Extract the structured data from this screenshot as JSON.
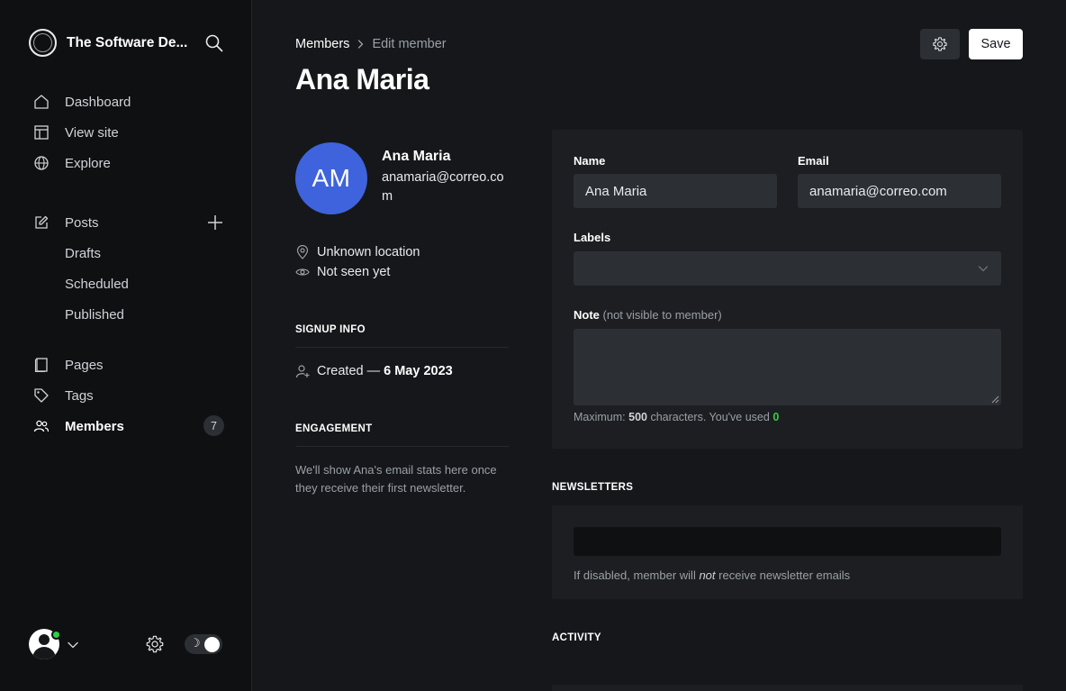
{
  "sidebar": {
    "site_title": "The Software De...",
    "nav_primary": [
      {
        "label": "Dashboard",
        "icon": "home-icon"
      },
      {
        "label": "View site",
        "icon": "layout-icon"
      },
      {
        "label": "Explore",
        "icon": "globe-icon"
      }
    ],
    "posts": {
      "label": "Posts",
      "icon": "edit-icon"
    },
    "posts_sub": [
      {
        "label": "Drafts"
      },
      {
        "label": "Scheduled"
      },
      {
        "label": "Published"
      }
    ],
    "nav_secondary": [
      {
        "label": "Pages",
        "icon": "page-icon"
      },
      {
        "label": "Tags",
        "icon": "tag-icon"
      },
      {
        "label": "Members",
        "icon": "members-icon",
        "badge": "7",
        "active": true
      }
    ],
    "theme_icon": "☽"
  },
  "header": {
    "breadcrumb_parent": "Members",
    "breadcrumb_current": "Edit member",
    "title": "Ana Maria",
    "save_label": "Save"
  },
  "member": {
    "initials": "AM",
    "name": "Ana Maria",
    "email": "anamaria@correo.com",
    "location": "Unknown location",
    "last_seen": "Not seen yet",
    "signup_heading": "SIGNUP INFO",
    "created_prefix": "Created —",
    "created_date": "6 May 2023",
    "engagement_heading": "ENGAGEMENT",
    "engagement_text": "We'll show Ana's email stats here once they receive their first newsletter."
  },
  "form": {
    "name_label": "Name",
    "name_value": "Ana Maria",
    "email_label": "Email",
    "email_value": "anamaria@correo.com",
    "labels_label": "Labels",
    "note_label": "Note",
    "note_hint": "(not visible to member)",
    "counter_prefix": "Maximum:",
    "counter_max": "500",
    "counter_mid": "characters. You've used",
    "counter_used": "0"
  },
  "newsletters": {
    "heading": "NEWSLETTERS",
    "help_prefix": "If disabled, member will",
    "help_em": "not",
    "help_suffix": "receive newsletter emails"
  },
  "activity": {
    "heading": "ACTIVITY"
  },
  "colors": {
    "accent_avatar": "#3e63dd",
    "online": "#30cf43",
    "background": "#15171a",
    "sidebar": "#0f1012"
  }
}
